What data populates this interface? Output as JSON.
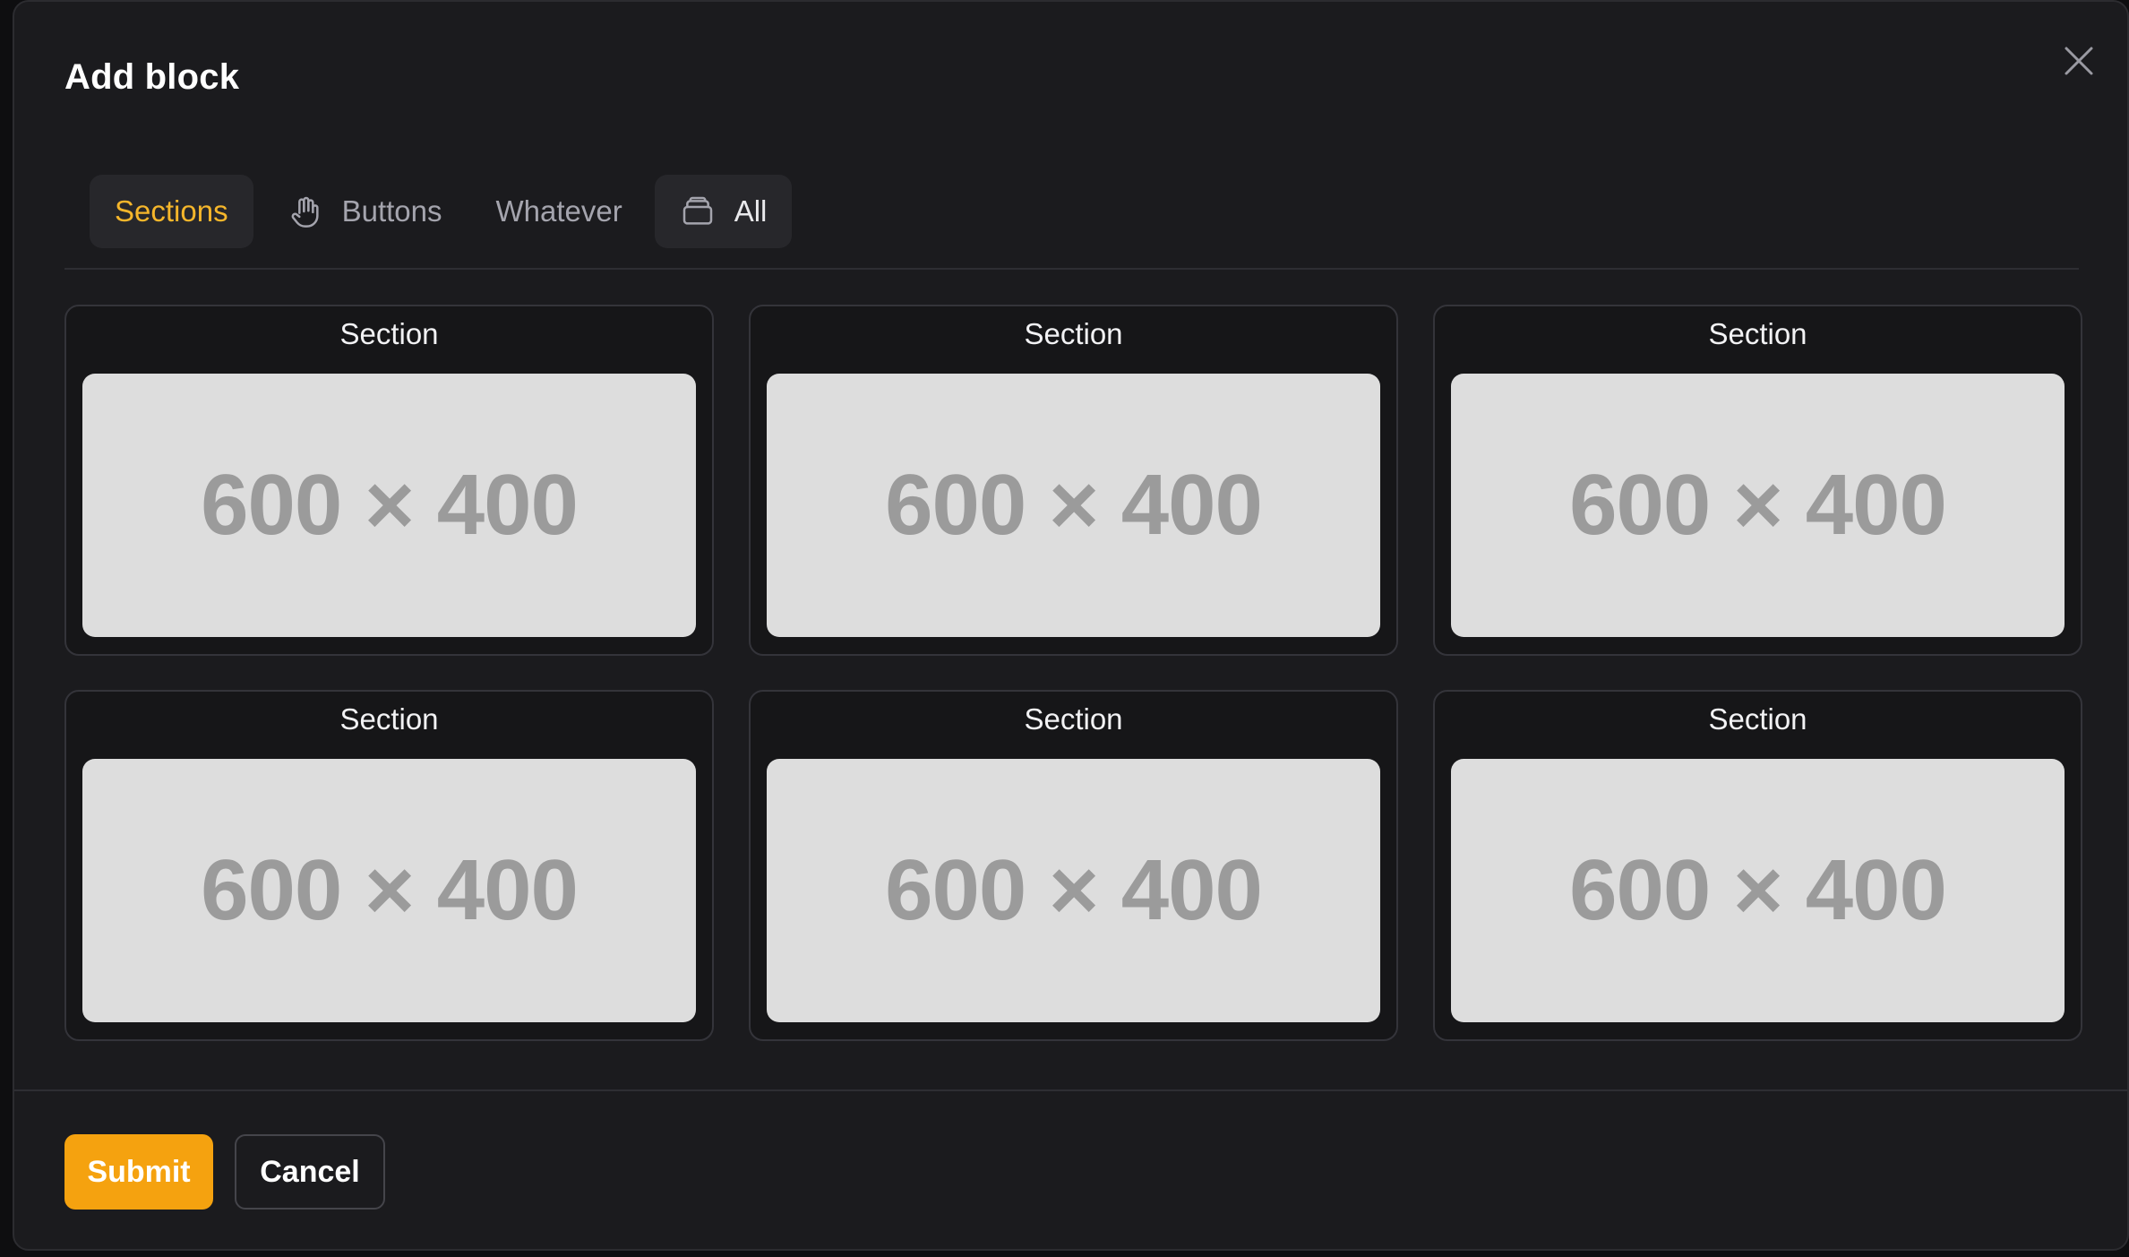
{
  "dialog": {
    "title": "Add block",
    "close_icon": "close-icon"
  },
  "tabs": [
    {
      "label": "Sections",
      "icon": null,
      "state": "active"
    },
    {
      "label": "Buttons",
      "icon": "hand-icon",
      "state": "default"
    },
    {
      "label": "Whatever",
      "icon": null,
      "state": "default"
    },
    {
      "label": "All",
      "icon": "archive-icon",
      "state": "highlighted"
    }
  ],
  "cards": [
    {
      "label": "Section",
      "thumbnail_text": "600 × 400"
    },
    {
      "label": "Section",
      "thumbnail_text": "600 × 400"
    },
    {
      "label": "Section",
      "thumbnail_text": "600 × 400"
    },
    {
      "label": "Section",
      "thumbnail_text": "600 × 400"
    },
    {
      "label": "Section",
      "thumbnail_text": "600 × 400"
    },
    {
      "label": "Section",
      "thumbnail_text": "600 × 400"
    }
  ],
  "footer": {
    "submit_label": "Submit",
    "cancel_label": "Cancel"
  },
  "colors": {
    "accent": "#f5a20f",
    "active_tab_text": "#f5b62b",
    "background": "#1b1b1e",
    "placeholder_bg": "#dddddd"
  }
}
